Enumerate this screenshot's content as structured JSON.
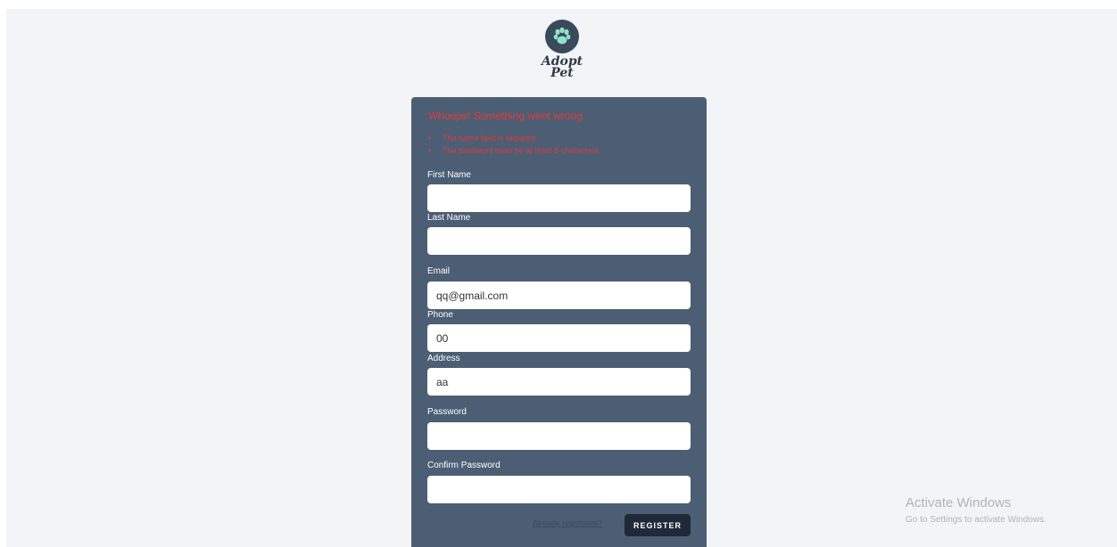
{
  "brand": {
    "line1": "Adopt",
    "line2": "Pet"
  },
  "errors": {
    "title": "Whoops! Something went wrong.",
    "items": [
      "The name field is required.",
      "The password must be at least 8 characters."
    ]
  },
  "form": {
    "first_name": {
      "label": "First Name",
      "value": ""
    },
    "last_name": {
      "label": "Last Name",
      "value": ""
    },
    "email": {
      "label": "Email",
      "value": "qq@gmail.com"
    },
    "phone": {
      "label": "Phone",
      "value": "00"
    },
    "address": {
      "label": "Address",
      "value": "aa"
    },
    "password": {
      "label": "Password",
      "value": ""
    },
    "confirm_password": {
      "label": "Confirm Password",
      "value": ""
    }
  },
  "footer": {
    "already_registered": "Already registered?",
    "register_label": "REGISTER"
  },
  "watermark": {
    "title": "Activate Windows",
    "subtitle": "Go to Settings to activate Windows."
  },
  "colors": {
    "card": "#4b5e74",
    "error": "#e33a3a",
    "button": "#1f2937",
    "logo": "#394a5c",
    "paw": "#8fe3c9"
  },
  "icons": {
    "logo": "paw-icon"
  }
}
